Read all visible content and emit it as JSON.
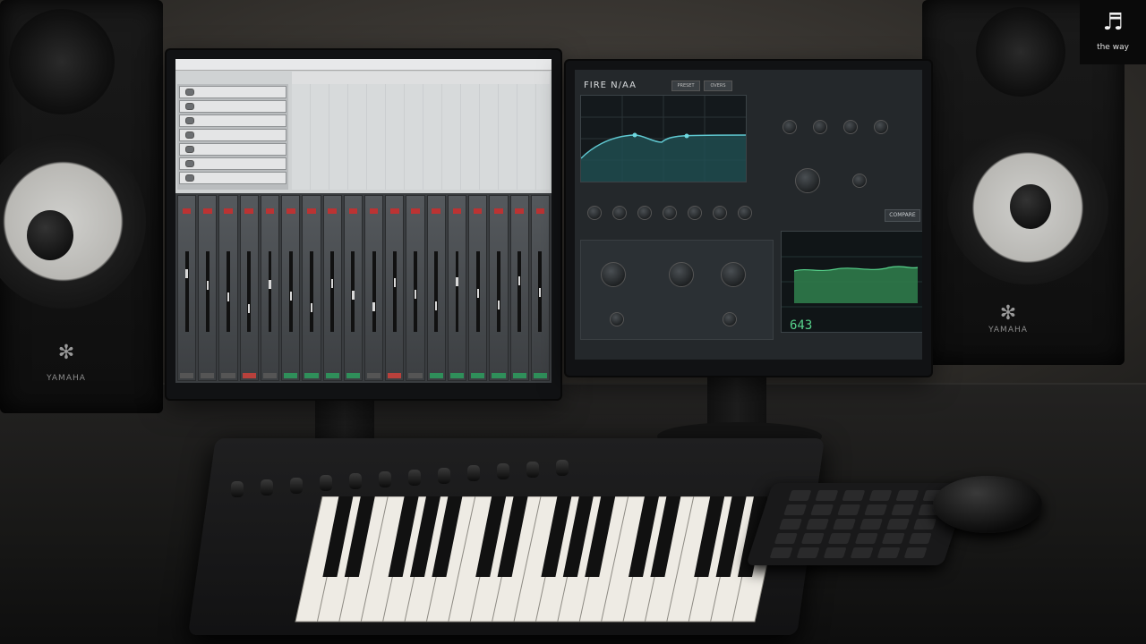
{
  "watermark": {
    "logo_glyph": "♬",
    "text": "the way"
  },
  "speakers": {
    "left": {
      "brand": "YAMAHA",
      "logo_glyph": "✻"
    },
    "right": {
      "brand": "YAMAHA",
      "logo_glyph": "✻"
    }
  },
  "daw_screen": {
    "track_count": 7,
    "mixer_channel_count": 18,
    "label_colors": [
      "#b8413c",
      "#2f8f5a"
    ]
  },
  "plugin_screen": {
    "title": "FIRE N/AA",
    "button_preset": "PRESET",
    "button_oversample": "OVERS",
    "button_compare": "COMPARE",
    "readout_value": "643",
    "accent_color": "#57d38c"
  }
}
